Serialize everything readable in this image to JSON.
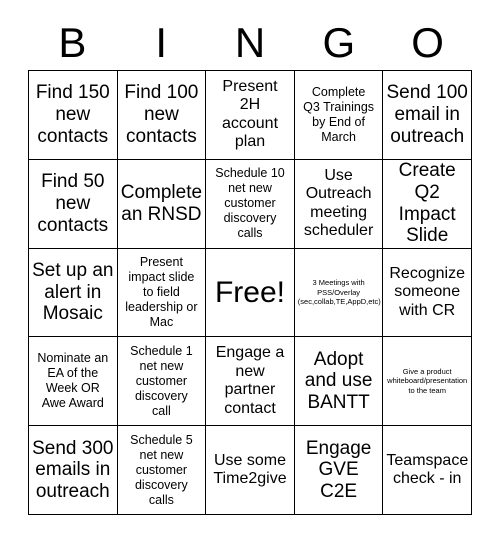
{
  "card": {
    "header_letters": [
      "B",
      "I",
      "N",
      "G",
      "O"
    ],
    "rows": [
      [
        {
          "text": "Find 150\nnew\ncontacts",
          "size": "lg",
          "name": "bingo-cell-b1"
        },
        {
          "text": "Find 100\nnew\ncontacts",
          "size": "lg",
          "name": "bingo-cell-i1"
        },
        {
          "text": "Present\n2H\naccount\nplan",
          "size": "md",
          "name": "bingo-cell-n1"
        },
        {
          "text": "Complete\nQ3 Trainings\nby End of\nMarch",
          "size": "sm",
          "name": "bingo-cell-g1"
        },
        {
          "text": "Send 100\nemail in\noutreach",
          "size": "lg",
          "name": "bingo-cell-o1"
        }
      ],
      [
        {
          "text": "Find 50\nnew\ncontacts",
          "size": "lg",
          "name": "bingo-cell-b2"
        },
        {
          "text": "Complete\nan RNSD",
          "size": "lg",
          "name": "bingo-cell-i2"
        },
        {
          "text": "Schedule 10\nnet new\ncustomer\ndiscovery\ncalls",
          "size": "sm",
          "name": "bingo-cell-n2"
        },
        {
          "text": "Use\nOutreach\nmeeting\nscheduler",
          "size": "md",
          "name": "bingo-cell-g2"
        },
        {
          "text": "Create Q2\nImpact\nSlide",
          "size": "lg",
          "name": "bingo-cell-o2"
        }
      ],
      [
        {
          "text": "Set up an\nalert in\nMosaic",
          "size": "lg",
          "name": "bingo-cell-b3"
        },
        {
          "text": "Present\nimpact slide\nto field\nleadership or\nMac",
          "size": "sm",
          "name": "bingo-cell-i3"
        },
        {
          "text": "Free!",
          "size": "xl",
          "name": "bingo-cell-free-space"
        },
        {
          "text": "3 Meetings with\nPSS/Overlay\n(sec,collab,TE,AppD,etc)",
          "size": "xs",
          "name": "bingo-cell-g3"
        },
        {
          "text": "Recognize\nsomeone\nwith CR",
          "size": "md",
          "name": "bingo-cell-o3"
        }
      ],
      [
        {
          "text": "Nominate an\nEA of the\nWeek OR\nAwe Award",
          "size": "sm",
          "name": "bingo-cell-b4"
        },
        {
          "text": "Schedule 1\nnet new\ncustomer\ndiscovery\ncall",
          "size": "sm",
          "name": "bingo-cell-i4"
        },
        {
          "text": "Engage a\nnew\npartner\ncontact",
          "size": "md",
          "name": "bingo-cell-n4"
        },
        {
          "text": "Adopt\nand use\nBANTT",
          "size": "lg",
          "name": "bingo-cell-g4"
        },
        {
          "text": "Give a product\nwhiteboard/presentation\nto the team",
          "size": "xs",
          "name": "bingo-cell-o4"
        }
      ],
      [
        {
          "text": "Send 300\nemails in\noutreach",
          "size": "lg",
          "name": "bingo-cell-b5"
        },
        {
          "text": "Schedule 5\nnet new\ncustomer\ndiscovery\ncalls",
          "size": "sm",
          "name": "bingo-cell-i5"
        },
        {
          "text": "Use some\nTime2give",
          "size": "md",
          "name": "bingo-cell-n5"
        },
        {
          "text": "Engage\nGVE\nC2E",
          "size": "lg",
          "name": "bingo-cell-g5"
        },
        {
          "text": "Teamspace\ncheck - in",
          "size": "md",
          "name": "bingo-cell-o5"
        }
      ]
    ]
  },
  "colors": {
    "background": "#ffffff",
    "text": "#000000",
    "border": "#000000"
  }
}
